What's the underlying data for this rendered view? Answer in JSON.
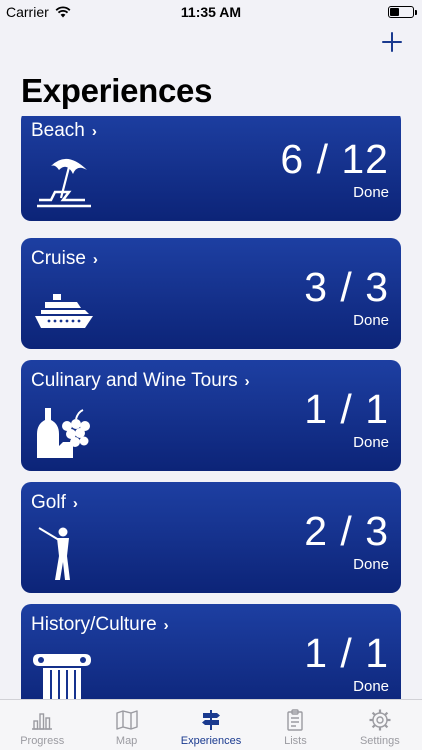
{
  "status_bar": {
    "carrier": "Carrier",
    "time": "11:35 AM"
  },
  "header": {
    "title": "Experiences",
    "add_icon": "plus-icon"
  },
  "experiences": [
    {
      "title": "Beach",
      "count": "6 / 12",
      "status": "Done",
      "icon": "beach-umbrella-icon"
    },
    {
      "title": "Cruise",
      "count": "3 / 3",
      "status": "Done",
      "icon": "cruise-ship-icon"
    },
    {
      "title": "Culinary and Wine Tours",
      "count": "1 / 1",
      "status": "Done",
      "icon": "wine-grapes-icon"
    },
    {
      "title": "Golf",
      "count": "2 / 3",
      "status": "Done",
      "icon": "golfer-icon"
    },
    {
      "title": "History/Culture",
      "count": "1 / 1",
      "status": "Done",
      "icon": "column-icon"
    }
  ],
  "tabs": [
    {
      "label": "Progress",
      "icon": "bar-chart-icon",
      "active": false
    },
    {
      "label": "Map",
      "icon": "map-icon",
      "active": false
    },
    {
      "label": "Experiences",
      "icon": "signpost-icon",
      "active": true
    },
    {
      "label": "Lists",
      "icon": "clipboard-icon",
      "active": false
    },
    {
      "label": "Settings",
      "icon": "gear-icon",
      "active": false
    }
  ],
  "colors": {
    "accent": "#1a3a8f",
    "card_top": "#1d3fa2",
    "card_bottom": "#0c2478",
    "inactive_tab": "#9b9ba1"
  }
}
